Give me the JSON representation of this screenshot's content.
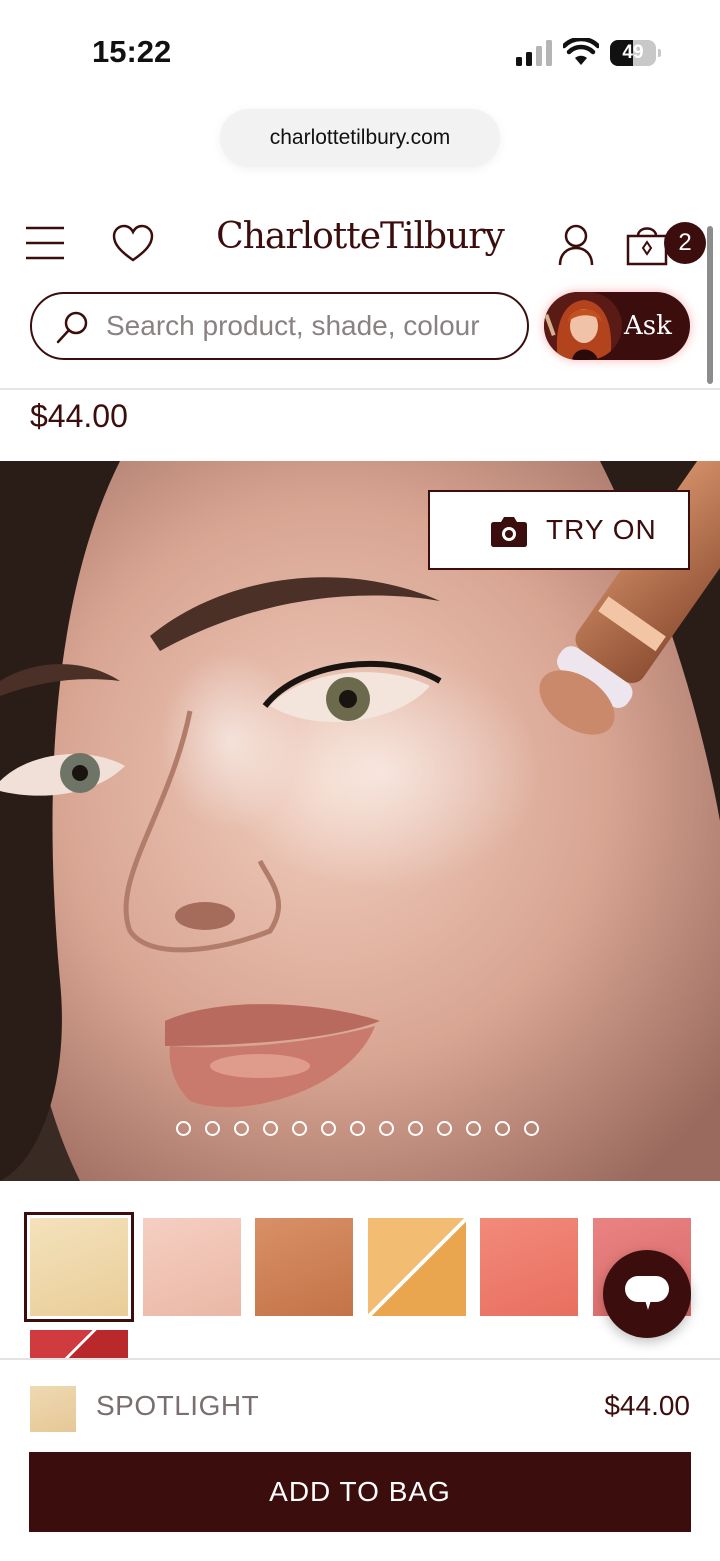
{
  "status_bar": {
    "time": "15:22",
    "battery": "49",
    "battery_level": 0.49
  },
  "browser": {
    "url": "charlottetilbury.com"
  },
  "header": {
    "logo": "CharlotteTilbury",
    "bag_count": "2",
    "search_placeholder": "Search product, shade, colour",
    "ask_label": "Ask"
  },
  "product": {
    "price": "$44.00",
    "try_on_label": "TRY ON",
    "image_count": 13,
    "active_image": 0
  },
  "swatches": [
    {
      "name": "spotlight",
      "colors": [
        "#f4e2bc",
        "#e9cd98"
      ],
      "selected": true,
      "split": false
    },
    {
      "name": "swatch-2",
      "colors": [
        "#f5cfc2",
        "#eab7a6"
      ],
      "selected": false,
      "split": false
    },
    {
      "name": "swatch-3",
      "colors": [
        "#d99066",
        "#c47348"
      ],
      "selected": false,
      "split": false
    },
    {
      "name": "swatch-4",
      "colors": [
        "#f2bc72",
        "#e9a64f"
      ],
      "selected": false,
      "split": true
    },
    {
      "name": "swatch-5",
      "colors": [
        "#f28a7a",
        "#e86f60"
      ],
      "selected": false,
      "split": false
    },
    {
      "name": "swatch-6",
      "colors": [
        "#e98382",
        "#d96a6a"
      ],
      "selected": false,
      "split": false
    },
    {
      "name": "swatch-7",
      "colors": [
        "#cf3b3e",
        "#b9282b"
      ],
      "selected": false,
      "split": true
    }
  ],
  "bottom_bar": {
    "shade_name": "SPOTLIGHT",
    "shade_color": "#efd9b2",
    "price": "$44.00",
    "add_to_bag": "ADD TO BAG"
  },
  "colors": {
    "brand": "#3b0d0c",
    "white": "#ffffff"
  }
}
